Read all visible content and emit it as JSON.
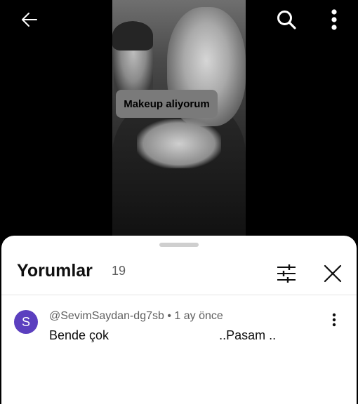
{
  "toolbar": {
    "back_icon": "arrow-left-icon",
    "search_icon": "search-icon",
    "more_icon": "more-vertical-icon"
  },
  "comments_sheet": {
    "title": "Yorumlar",
    "count": "19",
    "filter_icon": "filter-sliders-icon",
    "close_icon": "close-icon"
  },
  "comment": {
    "avatar_letter": "S",
    "avatar_color": "#5b3fbf",
    "meta": "@SevimSaydan-dg7sb • 1 ay önce",
    "text_start": "Bende çok",
    "text_end": "..Pasam .."
  },
  "overlay": {
    "label": "Makeup aliyorum"
  }
}
